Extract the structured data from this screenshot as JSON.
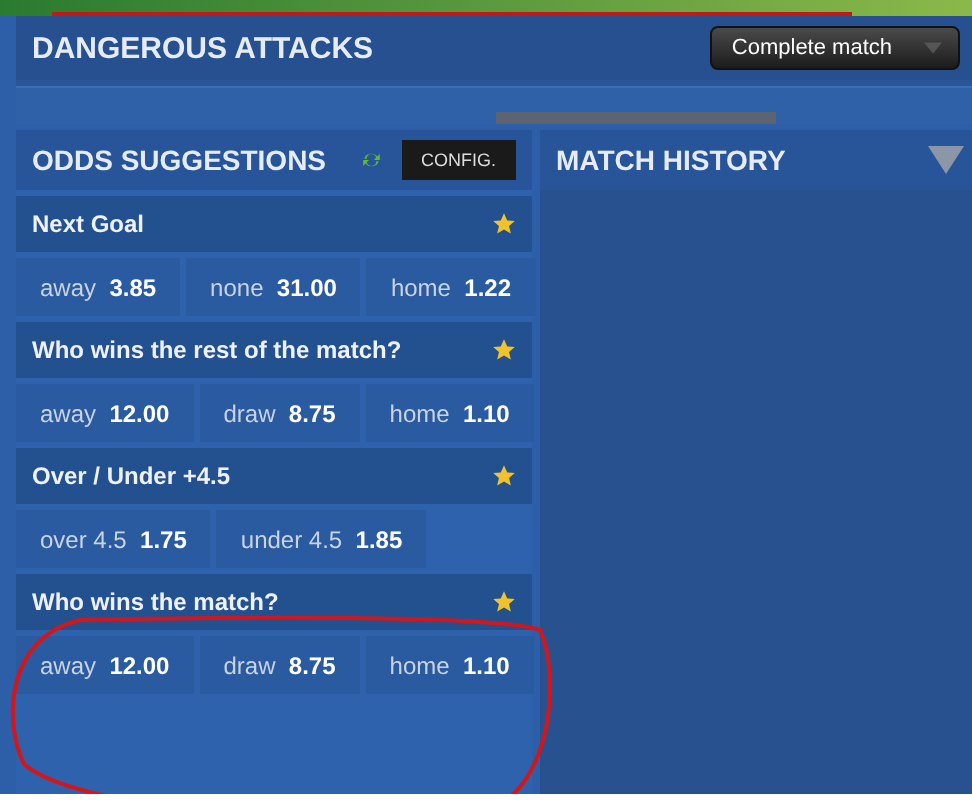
{
  "stats_panel": {
    "title": "DANGEROUS ATTACKS",
    "period_button": "Complete match"
  },
  "odds_panel": {
    "title": "ODDS SUGGESTIONS",
    "config_button": "CONFIG."
  },
  "markets": [
    {
      "title": "Next Goal",
      "starred": true,
      "options": [
        {
          "label": "away",
          "odd": "3.85"
        },
        {
          "label": "none",
          "odd": "31.00"
        },
        {
          "label": "home",
          "odd": "1.22"
        }
      ]
    },
    {
      "title": "Who wins the rest of the match?",
      "starred": true,
      "options": [
        {
          "label": "away",
          "odd": "12.00"
        },
        {
          "label": "draw",
          "odd": "8.75"
        },
        {
          "label": "home",
          "odd": "1.10"
        }
      ]
    },
    {
      "title": "Over / Under +4.5",
      "starred": true,
      "options": [
        {
          "label": "over 4.5",
          "odd": "1.75"
        },
        {
          "label": "under 4.5",
          "odd": "1.85"
        }
      ]
    },
    {
      "title": "Who wins the match?",
      "starred": true,
      "options": [
        {
          "label": "away",
          "odd": "12.00"
        },
        {
          "label": "draw",
          "odd": "8.75"
        },
        {
          "label": "home",
          "odd": "1.10"
        }
      ]
    }
  ],
  "history_panel": {
    "title": "MATCH HISTORY"
  }
}
